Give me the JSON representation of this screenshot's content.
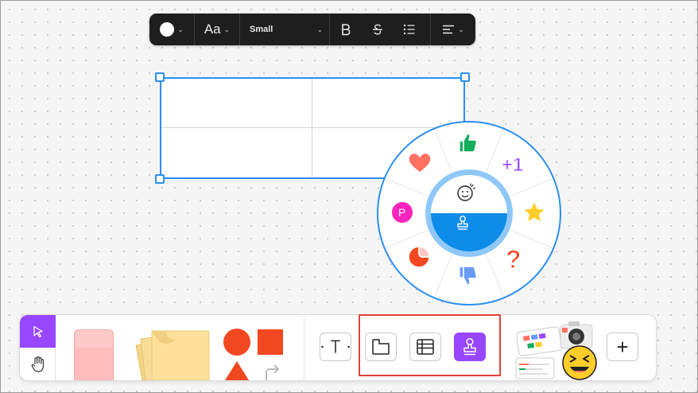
{
  "format_toolbar": {
    "font_size_label": "Small",
    "font_icon_label": "Aa",
    "text_color": "#ffffff"
  },
  "reaction_wheel": {
    "stickers": [
      "thumbs-up",
      "plus-one",
      "star",
      "question-mark",
      "thumbs-down",
      "red-sticker",
      "p-badge",
      "heart"
    ],
    "p_badge_label": "P",
    "plus_one_label": "+1",
    "question_label": "?"
  },
  "bottom_toolbar": {
    "plus_label": "+",
    "accent_color": "#9747ff",
    "stamp_color": "#9747ff"
  },
  "colors": {
    "selection": "#2b8ef2",
    "highlight": "#e0433e",
    "shape_red": "#f24822"
  }
}
